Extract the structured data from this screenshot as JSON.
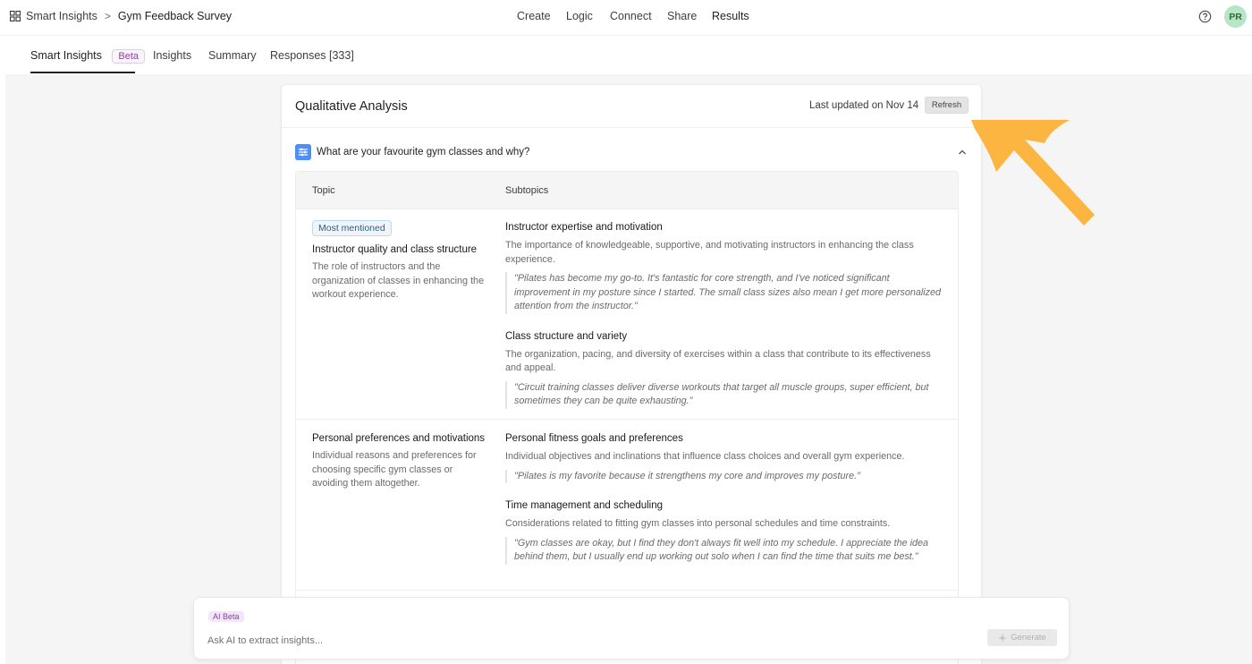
{
  "header": {
    "app_name": "Smart Insights",
    "separator": ">",
    "survey_name": "Gym Feedback Survey",
    "nav": [
      "Create",
      "Logic",
      "Connect",
      "Share",
      "Results"
    ],
    "active_nav": "Results",
    "user_initials": "PR"
  },
  "tabs": {
    "items": [
      "Smart Insights",
      "Insights",
      "Summary",
      "Responses [333]"
    ],
    "beta_label": "Beta"
  },
  "card": {
    "title": "Qualitative Analysis",
    "last_updated": "Last updated on Nov 14",
    "refresh_label": "Refresh",
    "question": "What are your favourite gym classes and why?",
    "columns": [
      "Topic",
      "Subtopics"
    ],
    "rows": [
      {
        "badge": "Most mentioned",
        "topic": "Instructor quality and class structure",
        "topic_desc": "The role of instructors and the organization of classes in enhancing the workout experience.",
        "subtopics": [
          {
            "title": "Instructor expertise and motivation",
            "desc": "The importance of knowledgeable, supportive, and motivating instructors in enhancing the class experience.",
            "quote": "\"Pilates has become my go-to. It's fantastic for core strength, and I've noticed significant improvement in my posture since I started. The small class sizes also mean I get more personalized attention from the instructor.\""
          },
          {
            "title": "Class structure and variety",
            "desc": "The organization, pacing, and diversity of exercises within a class that contribute to its effectiveness and appeal.",
            "quote": "\"Circuit training classes deliver diverse workouts that target all muscle groups, super efficient, but sometimes they can be quite exhausting.\""
          }
        ]
      },
      {
        "topic": "Personal preferences and motivations",
        "topic_desc": "Individual reasons and preferences for choosing specific gym classes or avoiding them altogether.",
        "subtopics": [
          {
            "title": "Personal fitness goals and preferences",
            "desc": "Individual objectives and inclinations that influence class choices and overall gym experience.",
            "quote": "\"Pilates is my favorite because it strengthens my core and improves my posture.\""
          },
          {
            "title": "Time management and scheduling",
            "desc": "Considerations related to fitting gym classes into personal schedules and time constraints.",
            "quote": "\"Gym classes are okay, but I find they don't always fit well into my schedule. I appreciate the idea behind them, but I usually end up working out solo when I can find the time that suits me best.\""
          }
        ]
      }
    ]
  },
  "ai_panel": {
    "badge": "AI Beta",
    "placeholder": "Ask AI to extract insights...",
    "generate_label": "Generate"
  },
  "colors": {
    "arrow": "#fbb540",
    "question_icon": "#4f8ff7",
    "avatar_bg": "#b7e6c4"
  }
}
